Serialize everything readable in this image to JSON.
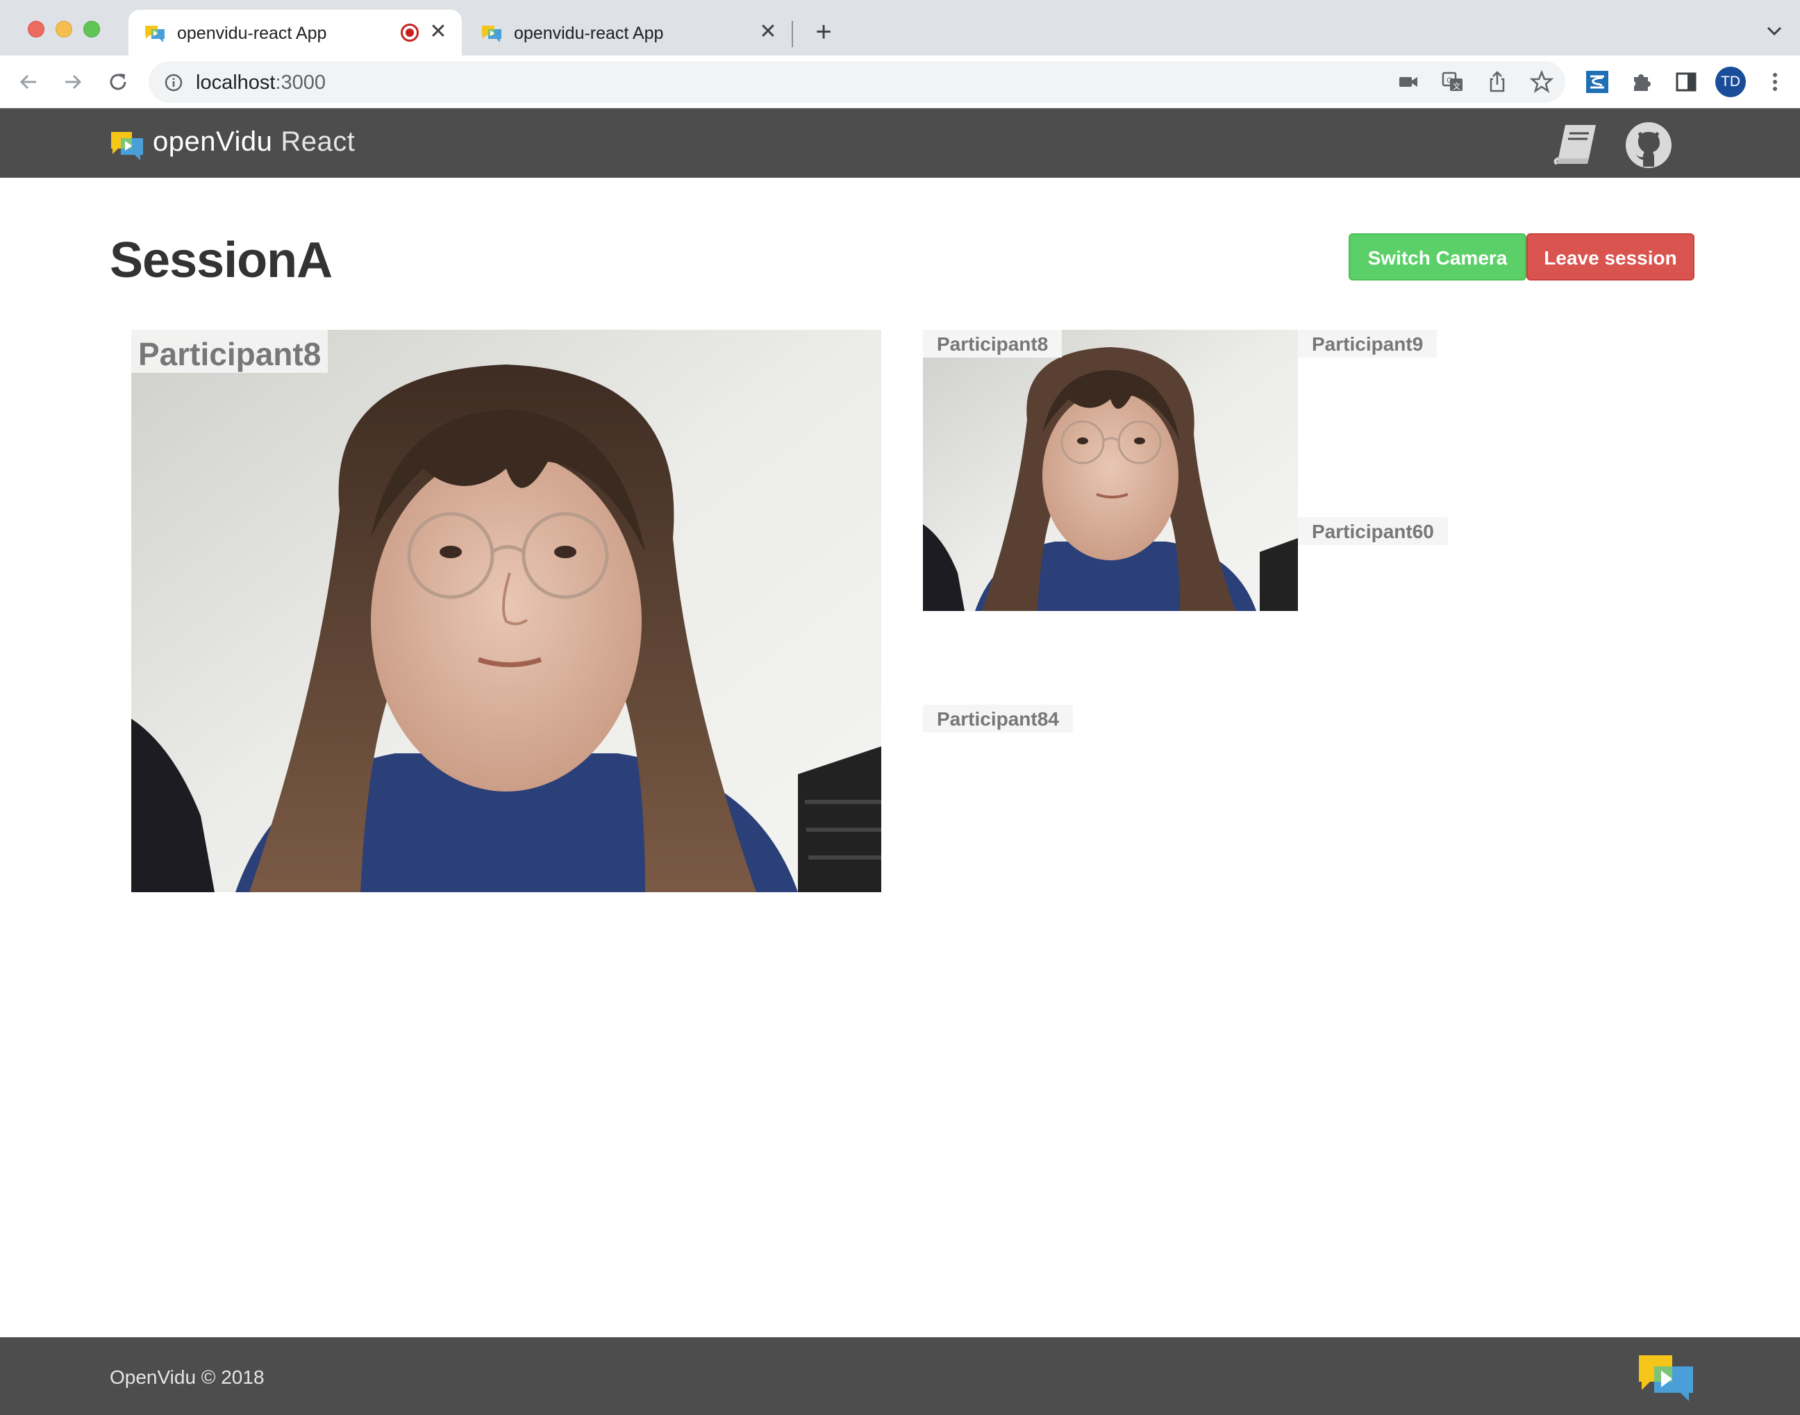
{
  "browser": {
    "tabs": [
      {
        "title": "openvidu-react App",
        "active": true,
        "recording": true
      },
      {
        "title": "openvidu-react App",
        "active": false
      }
    ],
    "address": {
      "host": "localhost",
      "port": ":3000"
    },
    "profile_initials": "TD",
    "icons": [
      "back-icon",
      "forward-icon",
      "reload-icon",
      "info-icon",
      "camera-icon",
      "translate-icon",
      "share-icon",
      "star-icon",
      "extension-s-icon",
      "puzzle-icon",
      "sidepanel-icon",
      "menu-dots-icon"
    ]
  },
  "header": {
    "brand": "openVidu",
    "brand_suffix": "React",
    "icons": [
      "docs-book-icon",
      "github-icon"
    ]
  },
  "session": {
    "title": "SessionA",
    "switch_camera_label": "Switch Camera",
    "leave_label": "Leave session"
  },
  "main_stream": {
    "name": "Participant8"
  },
  "streams": [
    {
      "name": "Participant8",
      "has_video": true
    },
    {
      "name": "Participant9",
      "has_video": false
    },
    {
      "name": "Participant60",
      "has_video": false
    },
    {
      "name": "Participant84",
      "has_video": false
    }
  ],
  "footer": {
    "text": "OpenVidu © 2018"
  },
  "colors": {
    "header_bg": "#4d4d4d",
    "switch_button": "#5cd068",
    "leave_button": "#d9534f",
    "title_text": "#333333",
    "name_tag_text": "#777777"
  }
}
